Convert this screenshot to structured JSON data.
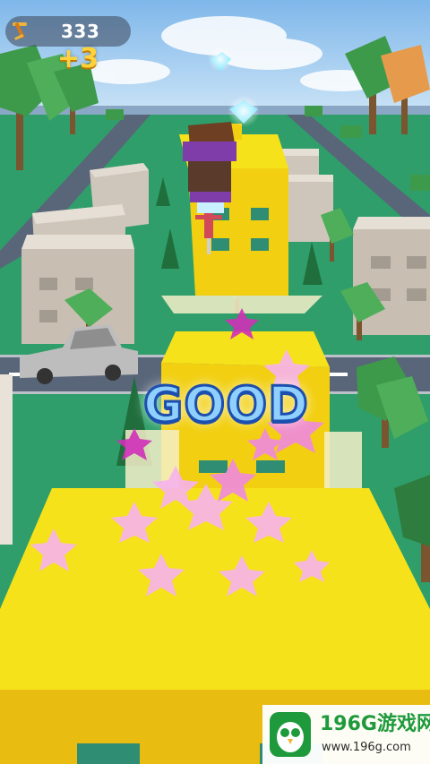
{
  "hud": {
    "score": "333",
    "bonus": "+3",
    "icon": "pogo-stick-icon"
  },
  "feedback": {
    "text": "GOOD"
  },
  "watermark": {
    "site_name": "196G游戏网",
    "url": "www.196g.com",
    "logo": "owl-logo-icon"
  },
  "colors": {
    "sky": "#a9d3f5",
    "grass": "#2f9e6a",
    "road": "#596579",
    "building_yellow": "#f6e21a",
    "building_gray": "#cfc6bb",
    "star_pink": "#f7b3ee",
    "good_text": "#8fd0ff",
    "good_outline": "#1d4fae",
    "score_bonus": "#ffd23a"
  }
}
